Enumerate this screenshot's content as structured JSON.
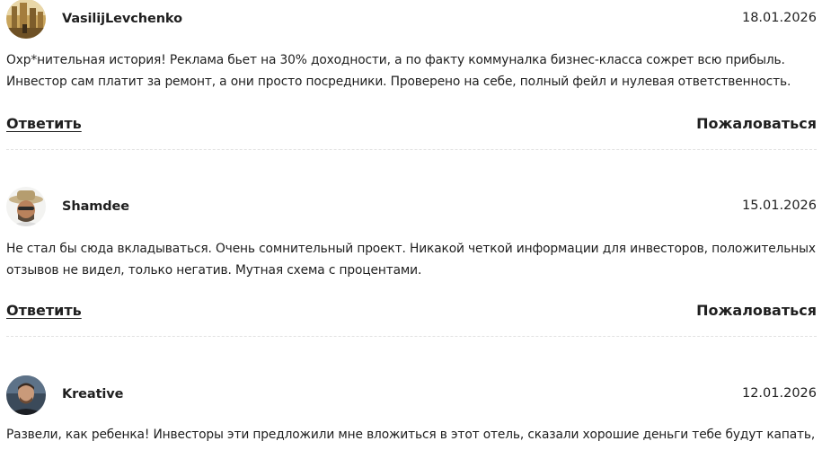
{
  "comments": [
    {
      "author": "VasilijLevchenko",
      "date": "18.01.2026",
      "avatar_icon": "avatar-photo-city",
      "text": "Охр*нительная история! Реклама бьет на 30% доходности, а по факту коммуналка бизнес-класса сожрет всю прибыль. Инвестор сам платит за ремонт, а они просто посредники. Проверено на себе, полный фейл и нулевая ответственность.",
      "reply_label": "Ответить",
      "report_label": "Пожаловаться"
    },
    {
      "author": "Shamdee",
      "date": "15.01.2026",
      "avatar_icon": "avatar-photo-hat-man",
      "text": "Не стал бы сюда вкладываться. Очень сомнительный проект. Никакой четкой информации для инвесторов, положительных отзывов не видел, только негатив. Мутная схема с процентами.",
      "reply_label": "Ответить",
      "report_label": "Пожаловаться"
    },
    {
      "author": "Kreative",
      "date": "12.01.2026",
      "avatar_icon": "avatar-photo-man",
      "text": "Развели, как ребенка! Инвесторы эти предложили мне вложиться в этот отель, сказали хорошие деньги тебе будут капать, я",
      "reply_label": "",
      "report_label": ""
    }
  ]
}
